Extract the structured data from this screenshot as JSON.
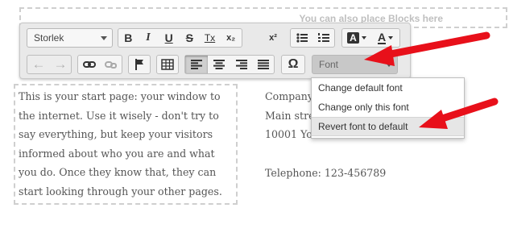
{
  "top_block": {
    "hint": "You can also place Blocks here"
  },
  "toolbar": {
    "font_size_combo": "Storlek",
    "bold": "B",
    "italic": "I",
    "underline": "U",
    "strike": "S",
    "clear_format": "Tx",
    "subscript": "x₂",
    "superscript": "x²",
    "text_color": "A",
    "bg_color": "A",
    "special_char": "Ω",
    "font_combo": "Font"
  },
  "content": {
    "left_lines": [
      "This is your start page: your window to",
      "the internet. Use it wisely - don't try to",
      "say everything, but keep your visitors",
      "informed about who you are and what",
      "you do. Once they know that, they can",
      "start looking through your other pages."
    ],
    "right_lines": [
      "Company",
      "Main street",
      "10001 York"
    ],
    "telephone": "Telephone: 123-456789"
  },
  "font_menu": {
    "items": [
      "Change default font",
      "Change only this font",
      "Revert font to default"
    ],
    "highlighted_index": 2
  },
  "colors": {
    "annotation_arrow": "#e8101a"
  }
}
